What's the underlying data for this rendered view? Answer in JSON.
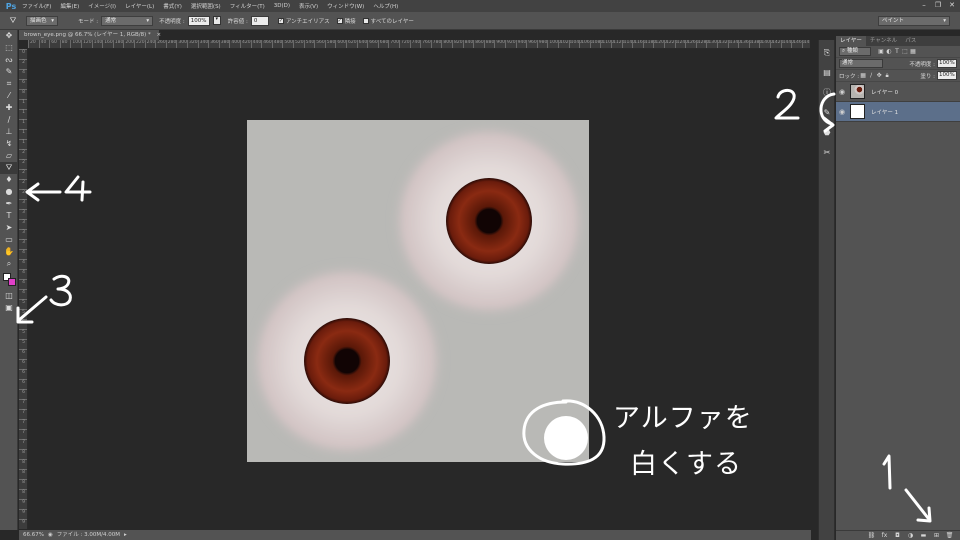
{
  "app": {
    "logo": "Ps"
  },
  "menu": [
    "ファイル(F)",
    "編集(E)",
    "イメージ(I)",
    "レイヤー(L)",
    "書式(Y)",
    "選択範囲(S)",
    "フィルター(T)",
    "3D(D)",
    "表示(V)",
    "ウィンドウ(W)",
    "ヘルプ(H)"
  ],
  "window_controls": {
    "minimize": "–",
    "restore": "❐",
    "close": "✕"
  },
  "options": {
    "preset": "描画色",
    "mode_label": "モード :",
    "mode_value": "通常",
    "opacity_label": "不透明度 :",
    "opacity_value": "100%",
    "tolerance_label": "許容値 :",
    "tolerance_value": "0",
    "antialias_label": "アンチエイリアス",
    "contiguous_label": "隣接",
    "all_layers_label": "すべてのレイヤー",
    "workspace": "ペイント"
  },
  "document": {
    "tab_title": "brown_eye.png @ 66.7% (レイヤー 1, RGB/8) *",
    "close": "×",
    "zoom": "66.67%",
    "file_info": "ファイル : 3.00M/4.00M",
    "hruler": [
      "20",
      "40",
      "60",
      "80",
      "100",
      "120",
      "140",
      "160",
      "180",
      "200",
      "220",
      "240",
      "260",
      "280",
      "300",
      "320",
      "340",
      "360",
      "380",
      "400",
      "420",
      "440",
      "460",
      "480",
      "500",
      "520",
      "540",
      "560",
      "580",
      "600",
      "620",
      "640",
      "660",
      "680",
      "700",
      "720",
      "740",
      "760",
      "780",
      "800",
      "820",
      "840",
      "860",
      "880",
      "900",
      "920",
      "940",
      "960",
      "980",
      "1000",
      "1020",
      "1040",
      "1060",
      "1080",
      "1100",
      "1120",
      "1140",
      "1160",
      "1180",
      "1200",
      "1220",
      "1240",
      "1260",
      "1280",
      "1300",
      "1320",
      "1340",
      "1360",
      "1380",
      "1400",
      "1420",
      "1440",
      "1460",
      "1480",
      "1500",
      "1520",
      "1540"
    ],
    "vruler": [
      "0",
      "2",
      "4",
      "6",
      "8",
      "1",
      "1",
      "1",
      "1",
      "1",
      "2",
      "2",
      "2",
      "2",
      "2",
      "3",
      "3",
      "3",
      "3",
      "3",
      "4",
      "4",
      "4",
      "4",
      "4",
      "5",
      "5",
      "5",
      "5",
      "5",
      "6",
      "6",
      "6",
      "6",
      "6",
      "7",
      "7",
      "7",
      "7",
      "7",
      "8",
      "8",
      "8",
      "8",
      "8",
      "9",
      "9",
      "9"
    ]
  },
  "layers_panel": {
    "tabs": [
      "レイヤー",
      "チャンネル",
      "パス"
    ],
    "kind_filter": "種類",
    "blend_mode": "通常",
    "opacity_label": "不透明度 :",
    "opacity_value": "100%",
    "lock_label": "ロック :",
    "fill_label": "塗り :",
    "fill_value": "100%",
    "layers": [
      {
        "name": "レイヤー 0",
        "selected": false
      },
      {
        "name": "レイヤー 1",
        "selected": true
      }
    ]
  },
  "annotations": {
    "n1": "1",
    "n2": "2",
    "n3": "3",
    "n4": "4",
    "alpha_line1": "アルファを",
    "alpha_line2": "白くする"
  },
  "colors": {
    "foreground": "#ffffff",
    "background": "#e040c8",
    "selected_layer": "#5c6f8a",
    "iris": "#7a2210",
    "canvas": "#b9b9b6"
  }
}
